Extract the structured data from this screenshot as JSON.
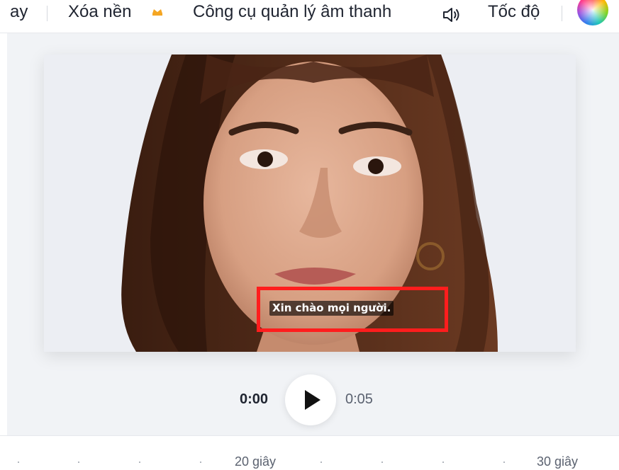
{
  "toolbar": {
    "items": {
      "partial_left": "ay",
      "remove_bg": "Xóa nền",
      "audio_tools": "Công cụ quản lý âm thanh",
      "speed": "Tốc độ"
    },
    "icons": [
      "crown-icon",
      "speaker-voice-icon",
      "color-wheel-icon"
    ]
  },
  "video": {
    "caption": "Xin chào mọi người.",
    "highlight_color": "#ff1d1d"
  },
  "player": {
    "current_time": "0:00",
    "duration": "0:05",
    "play_icon": "play-icon"
  },
  "timeline": {
    "labels": [
      "20 giây",
      "30 giây"
    ]
  }
}
